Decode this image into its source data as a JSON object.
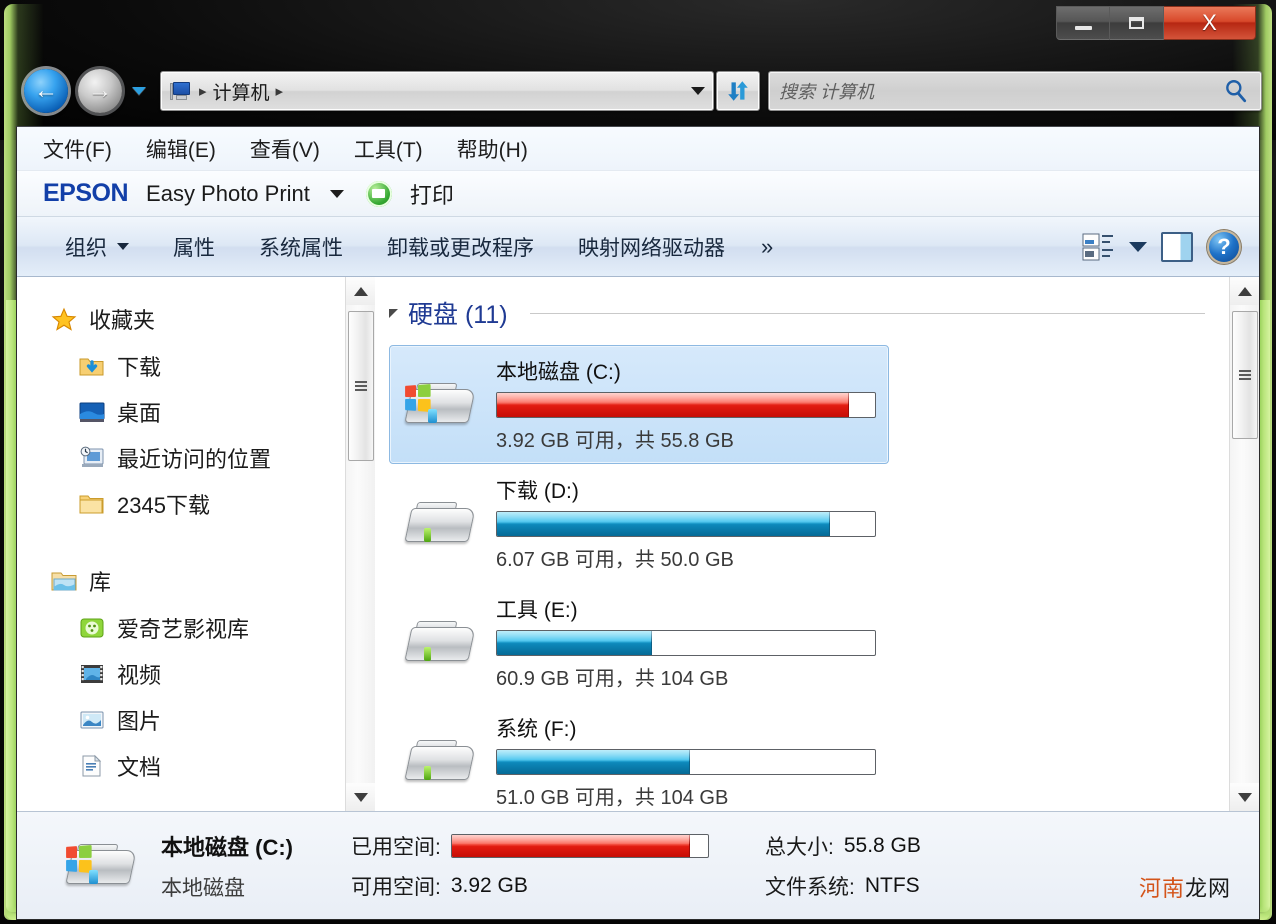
{
  "window": {
    "controls": {
      "minimize": "—",
      "maximize": "▭",
      "close": "X"
    }
  },
  "address_bar": {
    "back_glyph": "←",
    "forward_glyph": "→",
    "crumb_root_icon": "computer-icon",
    "crumb": "计算机",
    "separator": "▸",
    "refresh_glyph": "↻"
  },
  "search": {
    "placeholder": "搜索 计算机",
    "icon": "search-icon"
  },
  "menubar": {
    "items": [
      {
        "label": "文件(F)"
      },
      {
        "label": "编辑(E)"
      },
      {
        "label": "查看(V)"
      },
      {
        "label": "工具(T)"
      },
      {
        "label": "帮助(H)"
      }
    ]
  },
  "epson_bar": {
    "logo": "EPSON",
    "product": "Easy Photo Print",
    "print_label": "打印"
  },
  "command_bar": {
    "organize": "组织",
    "properties": "属性",
    "system_properties": "系统属性",
    "uninstall_program": "卸载或更改程序",
    "map_network_drive": "映射网络驱动器",
    "overflow": "»",
    "view_icon": "view-list-icon",
    "preview_pane_icon": "preview-pane-icon",
    "help_icon": "help-icon",
    "help_glyph": "?"
  },
  "nav_pane": {
    "sections": [
      {
        "name": "收藏夹",
        "icon": "star-icon",
        "children": [
          {
            "label": "下载",
            "icon": "download-folder-icon"
          },
          {
            "label": "桌面",
            "icon": "desktop-icon"
          },
          {
            "label": "最近访问的位置",
            "icon": "recent-places-icon"
          },
          {
            "label": "2345下载",
            "icon": "folder-icon"
          }
        ]
      },
      {
        "name": "库",
        "icon": "library-icon",
        "children": [
          {
            "label": "爱奇艺影视库",
            "icon": "iqiyi-library-icon"
          },
          {
            "label": "视频",
            "icon": "video-library-icon"
          },
          {
            "label": "图片",
            "icon": "pictures-library-icon"
          },
          {
            "label": "文档",
            "icon": "documents-library-icon"
          }
        ]
      }
    ]
  },
  "file_list": {
    "group_header": "硬盘 (11)",
    "drives": [
      {
        "name": "本地磁盘 (C:)",
        "capacity_text": "3.92 GB 可用，共 55.8 GB",
        "free": "3.92 GB",
        "total": "55.8 GB",
        "used_percent": 93,
        "bar_color": "red",
        "selected": true,
        "icon": "windows-drive-icon"
      },
      {
        "name": "下载 (D:)",
        "capacity_text": "6.07 GB 可用，共 50.0 GB",
        "free": "6.07 GB",
        "total": "50.0 GB",
        "used_percent": 88,
        "bar_color": "blue",
        "selected": false,
        "icon": "drive-icon"
      },
      {
        "name": "工具 (E:)",
        "capacity_text": "60.9 GB 可用，共 104 GB",
        "free": "60.9 GB",
        "total": "104 GB",
        "used_percent": 41,
        "bar_color": "blue",
        "selected": false,
        "icon": "drive-icon"
      },
      {
        "name": "系统 (F:)",
        "capacity_text": "51.0 GB 可用，共 104 GB",
        "free": "51.0 GB",
        "total": "104 GB",
        "used_percent": 51,
        "bar_color": "blue",
        "selected": false,
        "icon": "drive-icon"
      }
    ]
  },
  "details_pane": {
    "title": "本地磁盘 (C:)",
    "subtitle": "本地磁盘",
    "used_space_label": "已用空间:",
    "free_space_label": "可用空间:",
    "free_space_value": "3.92 GB",
    "total_size_label": "总大小:",
    "total_size_value": "55.8 GB",
    "file_system_label": "文件系统:",
    "file_system_value": "NTFS",
    "used_percent": 93
  },
  "watermark": {
    "part_a": "河南",
    "part_b": "龙网"
  },
  "colors": {
    "accent_blue": "#1f3a93",
    "bar_red": "#e21b10",
    "bar_blue": "#0d88bb",
    "frame_green": "#b9e57c",
    "epson_blue": "#123fa8"
  }
}
